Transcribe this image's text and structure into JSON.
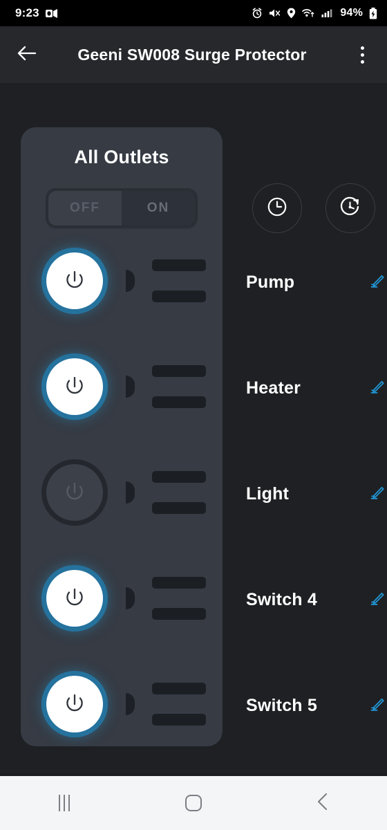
{
  "status_bar": {
    "time": "9:23",
    "left_icons": [
      "outlook-icon"
    ],
    "right_icons": [
      "alarm-icon",
      "mute-vibrate-icon",
      "location-icon",
      "wifi-icon",
      "cellular-signal-icon"
    ],
    "battery_percent": "94%",
    "battery_state": "charging"
  },
  "app_bar": {
    "back_icon": "back-arrow-icon",
    "title": "Geeni SW008 Surge Protector",
    "menu_icon": "overflow-menu-icon"
  },
  "strip": {
    "title": "All Outlets",
    "master_toggle": {
      "off_label": "OFF",
      "on_label": "ON",
      "selected": "OFF"
    }
  },
  "timers": [
    {
      "name": "schedule-timer-button",
      "icon": "clock-icon"
    },
    {
      "name": "countdown-timer-button",
      "icon": "countdown-timer-icon"
    }
  ],
  "outlets": [
    {
      "label": "Pump",
      "state": "on",
      "edit_icon": "edit-pencil-icon"
    },
    {
      "label": "Heater",
      "state": "on",
      "edit_icon": "edit-pencil-icon"
    },
    {
      "label": "Light",
      "state": "off",
      "edit_icon": "edit-pencil-icon"
    },
    {
      "label": "Switch 4",
      "state": "on",
      "edit_icon": "edit-pencil-icon"
    },
    {
      "label": "Switch 5",
      "state": "on",
      "edit_icon": "edit-pencil-icon"
    }
  ],
  "nav_bar": {
    "recents_label": "recents-icon",
    "home_label": "home-icon",
    "back_label": "back-icon"
  },
  "colors": {
    "page_background": "#1e2023",
    "app_bar": "#26282c",
    "strip_panel": "#363b44",
    "accent_blue": "#2196d6",
    "power_on_glow": "#2574a0",
    "nav_bar": "#f4f5f7"
  }
}
